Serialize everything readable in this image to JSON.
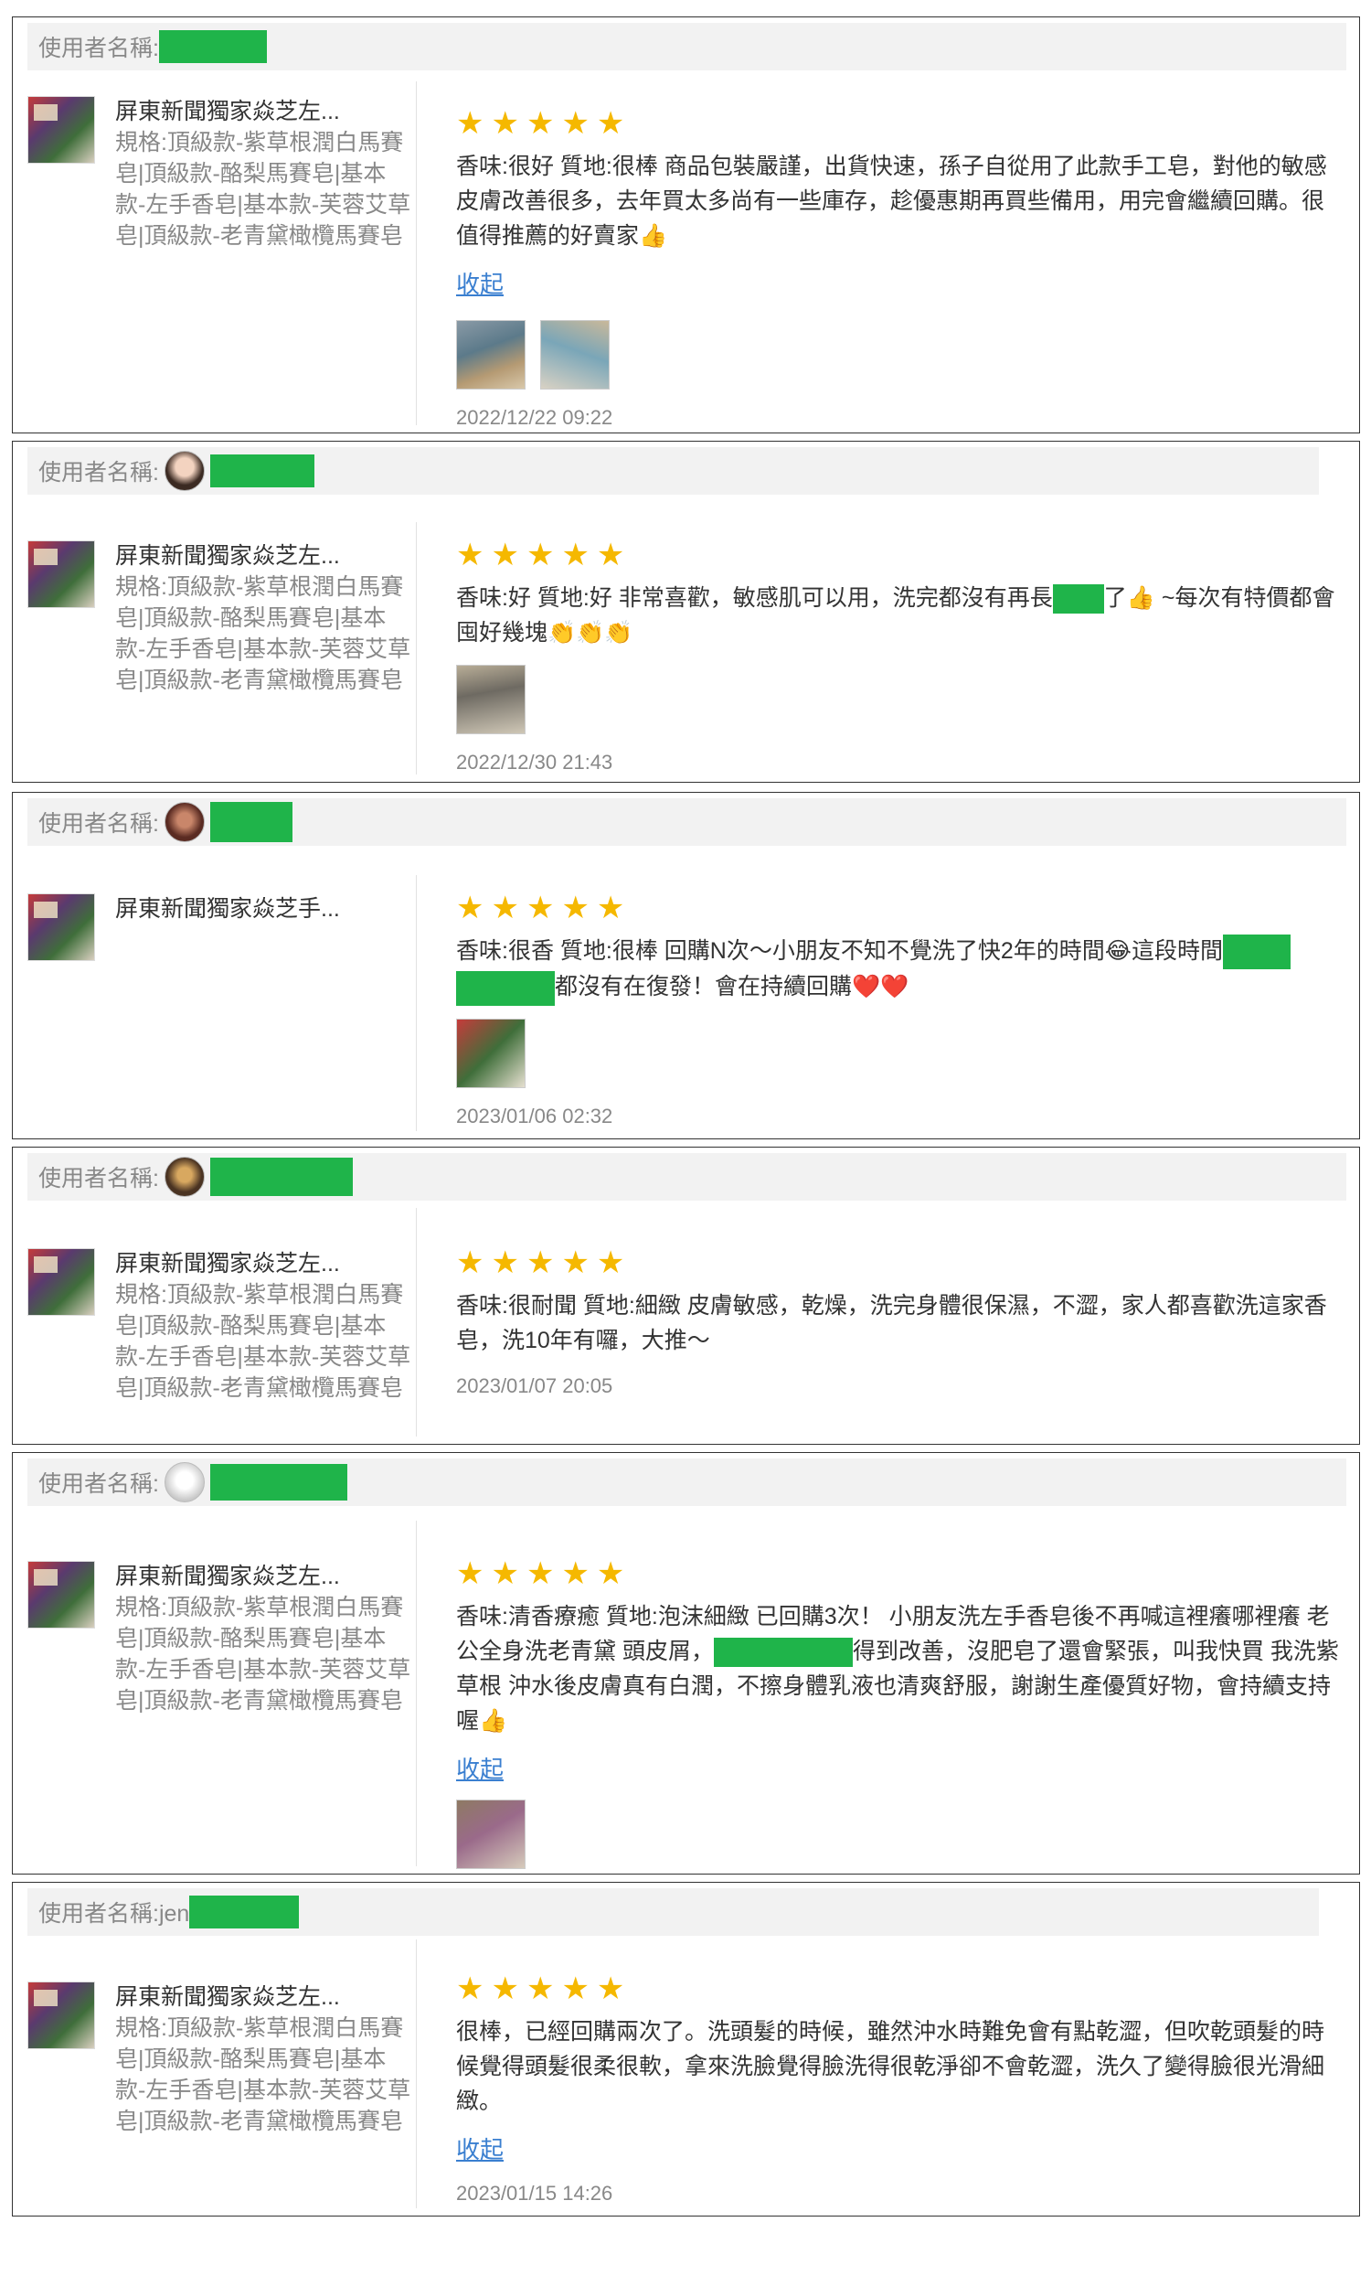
{
  "username_label_prefix": "使用者名稱:",
  "collapse_label": "收起",
  "reviews": [
    {
      "username_label": "使用者名稱:",
      "product_name": "屏東新聞獨家焱芝左...",
      "product_spec": "規格:頂級款-紫草根潤白馬賽皂|頂級款-酪梨馬賽皂|基本款-左手香皂|基本款-芙蓉艾草皂|頂級款-老青黛橄欖馬賽皂",
      "stars": "★★★★★",
      "content": "香味:很好 質地:很棒 商品包裝嚴謹，出貨快速，孫子自從用了此款手工皂，對他的敏感皮膚改善很多，去年買太多尚有一些庫存，趁優惠期再買些備用，用完會繼續回購。很值得推薦的好賣家👍",
      "timestamp": "2022/12/22 09:22"
    },
    {
      "username_label": "使用者名稱:",
      "product_name": "屏東新聞獨家焱芝左...",
      "product_spec": "規格:頂級款-紫草根潤白馬賽皂|頂級款-酪梨馬賽皂|基本款-左手香皂|基本款-芙蓉艾草皂|頂級款-老青黛橄欖馬賽皂",
      "stars": "★★★★★",
      "content_a": "香味:好 質地:好 非常喜歡，敏感肌可以用，洗完都沒有再長",
      "content_b": "了👍 ~每次有特價都會囤好幾塊👏👏👏",
      "timestamp": "2022/12/30 21:43"
    },
    {
      "username_label": "使用者名稱:",
      "product_name": "屏東新聞獨家焱芝手...",
      "stars": "★★★★★",
      "content_a": "香味:很香 質地:很棒 回購N次～小朋友不知不覺洗了快2年的時間😂這段時間",
      "content_b": "都沒有在復發！會在持續回購❤️❤️",
      "timestamp": "2023/01/06 02:32"
    },
    {
      "username_label": "使用者名稱:",
      "product_name": "屏東新聞獨家焱芝左...",
      "product_spec": "規格:頂級款-紫草根潤白馬賽皂|頂級款-酪梨馬賽皂|基本款-左手香皂|基本款-芙蓉艾草皂|頂級款-老青黛橄欖馬賽皂",
      "stars": "★★★★★",
      "content": "香味:很耐聞 質地:細緻 皮膚敏感，乾燥，洗完身體很保濕，不澀，家人都喜歡洗這家香皂，洗10年有囉，大推～",
      "timestamp": "2023/01/07 20:05"
    },
    {
      "username_label": "使用者名稱:",
      "product_name": "屏東新聞獨家焱芝左...",
      "product_spec": "規格:頂級款-紫草根潤白馬賽皂|頂級款-酪梨馬賽皂|基本款-左手香皂|基本款-芙蓉艾草皂|頂級款-老青黛橄欖馬賽皂",
      "stars": "★★★★★",
      "content_a": "香味:清香療癒 質地:泡沫細緻 已回購3次！ 小朋友洗左手香皂後不再喊這裡癢哪裡癢 老公全身洗老青黛 頭皮屑，",
      "content_b": "得到改善，沒肥皂了還會緊張，叫我快買 我洗紫草根 沖水後皮膚真有白潤，不擦身體乳液也清爽舒服，謝謝生產優質好物，會持續支持喔👍",
      "timestamp": ""
    },
    {
      "username_label": "使用者名稱:jen",
      "product_name": "屏東新聞獨家焱芝左...",
      "product_spec": "規格:頂級款-紫草根潤白馬賽皂|頂級款-酪梨馬賽皂|基本款-左手香皂|基本款-芙蓉艾草皂|頂級款-老青黛橄欖馬賽皂",
      "stars": "★★★★★",
      "content": "很棒，已經回購兩次了。洗頭髮的時候，雖然沖水時難免會有點乾澀，但吹乾頭髮的時候覺得頭髮很柔很軟，拿來洗臉覺得臉洗得很乾淨卻不會乾澀，洗久了變得臉很光滑細緻。",
      "timestamp": "2023/01/15 14:26"
    }
  ]
}
